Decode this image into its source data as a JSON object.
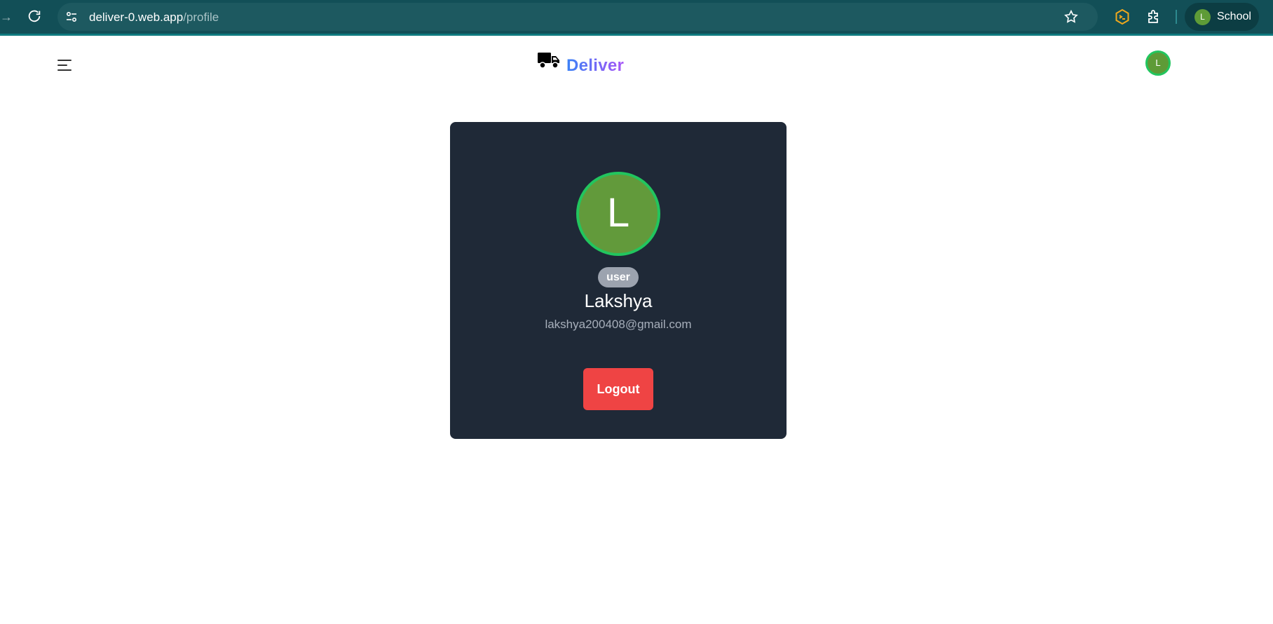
{
  "browser": {
    "url_host": "deliver-0.web.app",
    "url_path": "/profile",
    "profile": {
      "initial": "L",
      "label": "School"
    }
  },
  "header": {
    "brand": "Deliver",
    "avatar_initial": "L"
  },
  "profile_card": {
    "avatar_initial": "L",
    "role": "user",
    "name": "Lakshya",
    "email": "lakshya200408@gmail.com",
    "logout_label": "Logout"
  },
  "colors": {
    "browser_bar": "#124f57",
    "brand_gradient": [
      "#3b82f6",
      "#a855f7"
    ],
    "card_bg": "#1f2937",
    "avatar_ring": "#22c55e",
    "avatar_fill": "#629a3b",
    "logout": "#ef4444"
  },
  "icons": [
    "forward-icon",
    "reload-icon",
    "site-info-icon",
    "star-icon",
    "extension-icon",
    "puzzle-icon",
    "menu-icon",
    "truck-icon"
  ]
}
